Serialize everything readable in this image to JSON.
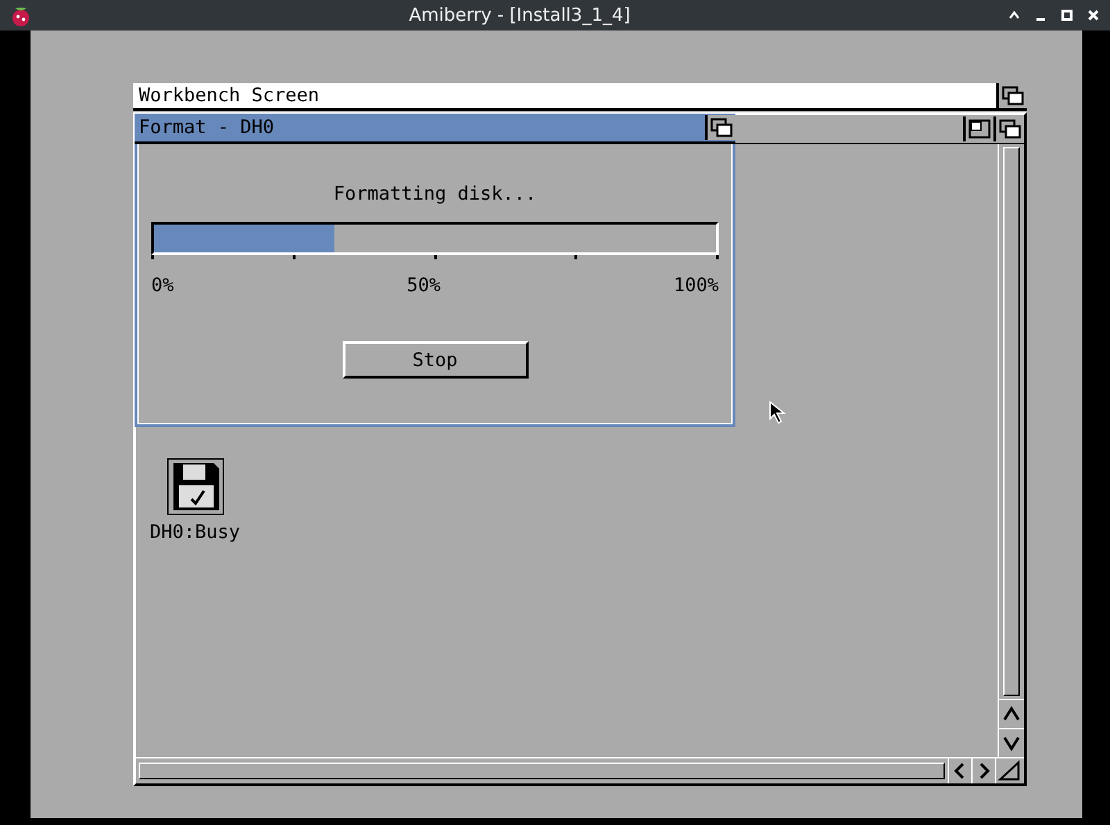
{
  "window": {
    "title": "Amiberry - [Install3_1_4]"
  },
  "screen": {
    "title": "Workbench Screen"
  },
  "drawer_window": {
    "icons": [
      {
        "label": "DH0:Busy"
      }
    ]
  },
  "format_window": {
    "title": "Format - DH0",
    "message": "Formatting disk...",
    "progress": {
      "level": 0.32
    },
    "scale": [
      "0%",
      "50%",
      "100%"
    ],
    "buttons": [
      "Stop"
    ]
  }
}
